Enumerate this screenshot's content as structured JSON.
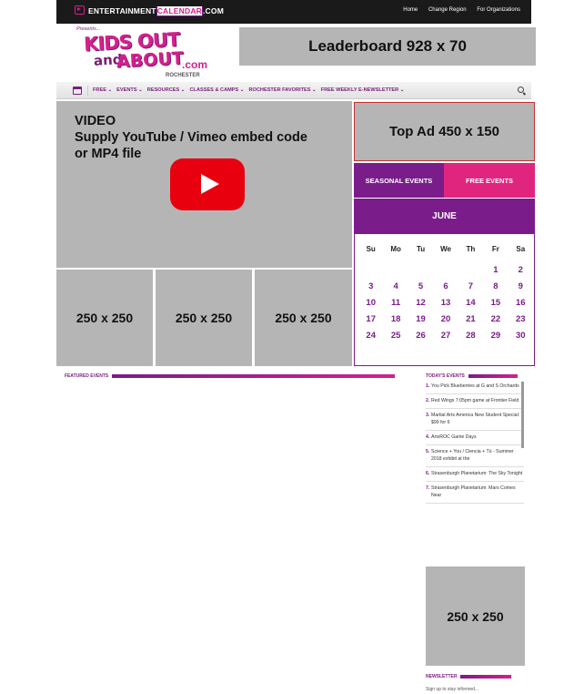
{
  "topbar": {
    "brand_main": "ENTERTAINMENT",
    "brand_cal": "CALENDAR",
    "brand_com": ".COM",
    "links": [
      "Home",
      "Change Region",
      "For Organizations"
    ]
  },
  "logo": {
    "presents": "Presents...",
    "kids": "KIDS OUT",
    "and": "and",
    "about": "ABOUT",
    ".com": ".com",
    "region": "ROCHESTER"
  },
  "leaderboard": "Leaderboard 928 x 70",
  "nav": {
    "items": [
      "FREE ⌄",
      "EVENTS ⌄",
      "RESOURCES ⌄",
      "CLASSES & CAMPS ⌄",
      "ROCHESTER FAVORITES ⌄",
      "FREE WEEKLY E-NEWSLETTER ⌄"
    ]
  },
  "video": {
    "text": "VIDEO\nSupply YouTube / Vimeo embed code\nor MP4 file"
  },
  "ads": {
    "small": [
      "250 x 250",
      "250 x 250",
      "250 x 250"
    ],
    "top": "Top Ad 450 x 150",
    "sidebar": "250 x 250"
  },
  "calendar": {
    "tab_seasonal": "SEASONAL EVENTS",
    "tab_free": "FREE EVENTS",
    "month": "JUNE",
    "days": [
      "Su",
      "Mo",
      "Tu",
      "We",
      "Th",
      "Fr",
      "Sa"
    ],
    "dates": [
      "",
      "",
      "",
      "",
      "",
      "1",
      "2",
      "3",
      "4",
      "5",
      "6",
      "7",
      "8",
      "9",
      "10",
      "11",
      "12",
      "13",
      "14",
      "15",
      "16",
      "17",
      "18",
      "19",
      "20",
      "21",
      "22",
      "23",
      "24",
      "25",
      "26",
      "27",
      "28",
      "29",
      "30"
    ]
  },
  "featured": {
    "title": "FEATURED EVENTS"
  },
  "today": {
    "title": "TODAY'S EVENTS",
    "items": [
      {
        "n": "1.",
        "t": "You Pick Blueberries at G and S Orchards"
      },
      {
        "n": "2.",
        "t": "Red Wings 7:05pm game at Frontier Field"
      },
      {
        "n": "3.",
        "t": "Martial Arts America New Student Special: $99 for 6"
      },
      {
        "n": "4.",
        "t": "ArtsROC Game Days"
      },
      {
        "n": "5.",
        "t": "Science + You / Ciencia + Tú - Summer 2018 exhibit at the"
      },
      {
        "n": "6.",
        "t": "Strasenburgh Planetarium: The Sky Tonight"
      },
      {
        "n": "7.",
        "t": "Strasenburgh Planetarium: Mars Comes Near"
      }
    ]
  },
  "newsletter": {
    "title": "NEWSLETTER",
    "sub": "Sign up to stay informed..."
  },
  "colors": {
    "purple": "#7a1c8a",
    "pink": "#e0257f",
    "gray_ad": "#b5b5b5"
  }
}
